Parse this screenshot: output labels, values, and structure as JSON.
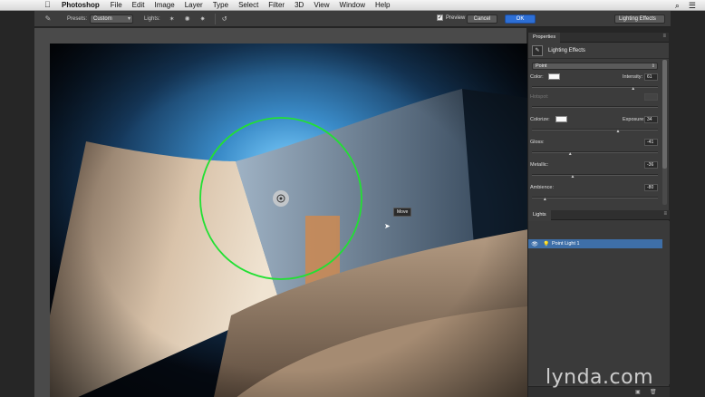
{
  "menubar": {
    "app": "Photoshop",
    "items": [
      "File",
      "Edit",
      "Image",
      "Layer",
      "Type",
      "Select",
      "Filter",
      "3D",
      "View",
      "Window",
      "Help"
    ]
  },
  "options": {
    "presets_label": "Presets:",
    "presets_value": "Custom",
    "lights_label": "Lights:",
    "preview_label": "Preview",
    "preview_checked": true,
    "cancel": "Cancel",
    "ok": "OK",
    "workspace": "Lighting Effects"
  },
  "canvas": {
    "tooltip": "Move"
  },
  "properties": {
    "tab": "Properties",
    "title": "Lighting Effects",
    "light_type": "Point",
    "color_label": "Color:",
    "intensity_label": "Intensity:",
    "intensity_value": "61",
    "hotspot_label": "Hotspot:",
    "colorize_label": "Colorize:",
    "exposure_label": "Exposure:",
    "exposure_value": "34",
    "gloss_label": "Gloss:",
    "gloss_value": "-41",
    "metallic_label": "Metallic:",
    "metallic_value": "-36",
    "ambience_label": "Ambience:",
    "ambience_value": "-80",
    "sliders": {
      "intensity": 0.8,
      "exposure": 0.68,
      "gloss": 0.3,
      "metallic": 0.32,
      "ambience": 0.1
    }
  },
  "lights_panel": {
    "tab": "Lights",
    "items": [
      "Point Light 1"
    ]
  },
  "watermark": "lynda.com",
  "colors": {
    "accent": "#2d6fd6",
    "selection": "#3e6fa8",
    "light_ring": "#22e033"
  }
}
